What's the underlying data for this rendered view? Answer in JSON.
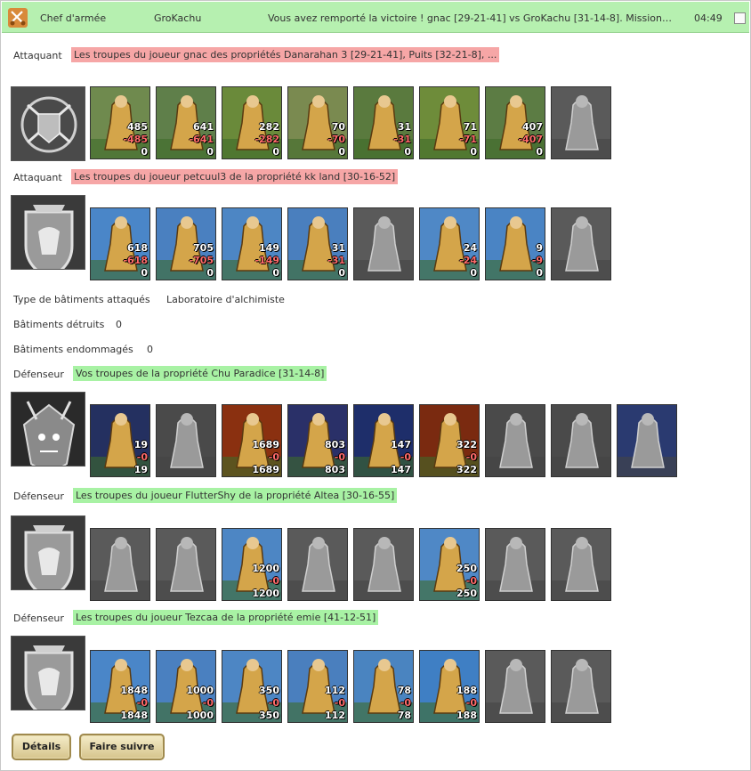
{
  "header": {
    "chef_label": "Chef d'armée",
    "opponent": "GroKachu",
    "message": "Vous avez remporté la victoire ! gnac [29-21-41] vs GroKachu [31-14-8]. Mission…",
    "time": "04:49"
  },
  "battle": {
    "attackers": [
      {
        "label": "Attaquant",
        "troops": "Les troupes du joueur gnac des propriétés Danarahan 3 [29-21-41], Puits [32-21-8], ...",
        "crest_icon": "paladin-crest-icon",
        "units": [
          {
            "icon": "dwarf-unit-icon",
            "count": "485",
            "loss": "-485",
            "remain": "0",
            "color": "#6f8a4e"
          },
          {
            "icon": "swordsman-unit-icon",
            "count": "641",
            "loss": "-641",
            "remain": "0",
            "color": "#5f7f4a"
          },
          {
            "icon": "spearman-unit-icon",
            "count": "282",
            "loss": "-282",
            "remain": "0",
            "color": "#6a8a3a"
          },
          {
            "icon": "griffin-unit-icon",
            "count": "70",
            "loss": "-70",
            "remain": "0",
            "color": "#7a8a50"
          },
          {
            "icon": "archer-unit-icon",
            "count": "31",
            "loss": "-31",
            "remain": "0",
            "color": "#5a7a3e"
          },
          {
            "icon": "elf-mage-unit-icon",
            "count": "71",
            "loss": "-71",
            "remain": "0",
            "color": "#6e8c3a"
          },
          {
            "icon": "monk-unit-icon",
            "count": "407",
            "loss": "-407",
            "remain": "0",
            "color": "#5c7c44"
          },
          {
            "icon": "ogre-unit-icon",
            "count": "",
            "loss": "",
            "remain": "",
            "color": "#5a5a5a"
          }
        ]
      },
      {
        "label": "Attaquant",
        "troops": "Les troupes du joueur petcuul3 de la propriété kk land [30-16-52]",
        "crest_icon": "lion-shield-crest-icon",
        "units": [
          {
            "icon": "dwarf-gold-unit-icon",
            "count": "618",
            "loss": "-618",
            "remain": "0",
            "color": "#4a86c8"
          },
          {
            "icon": "paladin-unit-icon",
            "count": "705",
            "loss": "-705",
            "remain": "0",
            "color": "#4a80c0"
          },
          {
            "icon": "lancer-unit-icon",
            "count": "149",
            "loss": "-149",
            "remain": "0",
            "color": "#4d86c4"
          },
          {
            "icon": "pegasus-unit-icon",
            "count": "31",
            "loss": "-31",
            "remain": "0",
            "color": "#4a7fbe"
          },
          {
            "icon": "crossbow-unit-icon",
            "count": "",
            "loss": "",
            "remain": "",
            "color": "#5a5a5a"
          },
          {
            "icon": "priest-unit-icon",
            "count": "24",
            "loss": "-24",
            "remain": "0",
            "color": "#4f88c6"
          },
          {
            "icon": "guardian-unit-icon",
            "count": "9",
            "loss": "-9",
            "remain": "0",
            "color": "#4a84c4"
          },
          {
            "icon": "ghost-unit-icon",
            "count": "",
            "loss": "",
            "remain": "",
            "color": "#5a5a5a"
          }
        ]
      }
    ],
    "info": {
      "type_label": "Type de bâtiments attaqués",
      "type_value": "Laboratoire d'alchimiste",
      "destroyed_label": "Bâtiments détruits",
      "destroyed_value": "0",
      "damaged_label": "Bâtiments endommagés",
      "damaged_value": "0"
    },
    "defenders": [
      {
        "label": "Défenseur",
        "troops": "Vos troupes de la propriété Chu Paradice [31-14-8]",
        "crest_icon": "demon-crest-icon",
        "units": [
          {
            "icon": "imp-unit-icon",
            "count": "19",
            "loss": "-0",
            "remain": "19",
            "color": "#243060"
          },
          {
            "icon": "skeleton-unit-icon",
            "count": "",
            "loss": "",
            "remain": "",
            "color": "#4a4a4a"
          },
          {
            "icon": "fire-beast-unit-icon",
            "count": "1689",
            "loss": "-0",
            "remain": "1689",
            "color": "#8a3010"
          },
          {
            "icon": "dragon-unit-icon",
            "count": "803",
            "loss": "-0",
            "remain": "803",
            "color": "#2a3068"
          },
          {
            "icon": "fire-elemental-unit-icon",
            "count": "147",
            "loss": "-0",
            "remain": "147",
            "color": "#1e2e6a"
          },
          {
            "icon": "pit-lord-unit-icon",
            "count": "322",
            "loss": "-0",
            "remain": "322",
            "color": "#7a2a10"
          },
          {
            "icon": "warlord-unit-icon",
            "count": "",
            "loss": "",
            "remain": "",
            "color": "#4a4a4a"
          },
          {
            "icon": "wraith-unit-icon",
            "count": "",
            "loss": "",
            "remain": "",
            "color": "#4a4a4a"
          },
          {
            "icon": "war-machine-unit-icon",
            "count": "",
            "loss": "",
            "remain": "",
            "color": "#2a3a70"
          }
        ]
      },
      {
        "label": "Défenseur",
        "troops": "Les troupes du joueur FlutterShy de la propriété Altea [30-16-55]",
        "crest_icon": "lion-shield-crest-icon",
        "units": [
          {
            "icon": "dwarf-gold-unit-icon",
            "count": "",
            "loss": "",
            "remain": "",
            "color": "#5a5a5a"
          },
          {
            "icon": "spearman-unit-icon",
            "count": "",
            "loss": "",
            "remain": "",
            "color": "#5a5a5a"
          },
          {
            "icon": "lancer-unit-icon",
            "count": "1200",
            "loss": "-0",
            "remain": "1200",
            "color": "#4d86c4"
          },
          {
            "icon": "pegasus-unit-icon",
            "count": "",
            "loss": "",
            "remain": "",
            "color": "#5a5a5a"
          },
          {
            "icon": "crossbow-unit-icon",
            "count": "",
            "loss": "",
            "remain": "",
            "color": "#5a5a5a"
          },
          {
            "icon": "priest-unit-icon",
            "count": "250",
            "loss": "-0",
            "remain": "250",
            "color": "#4f88c6"
          },
          {
            "icon": "guardian-unit-icon",
            "count": "",
            "loss": "",
            "remain": "",
            "color": "#5a5a5a"
          },
          {
            "icon": "ghost-unit-icon",
            "count": "",
            "loss": "",
            "remain": "",
            "color": "#5a5a5a"
          }
        ]
      },
      {
        "label": "Défenseur",
        "troops": "Les troupes du joueur Tezcaa de la propriété emie [41-12-51]",
        "crest_icon": "lion-shield-crest-icon",
        "units": [
          {
            "icon": "dwarf-gold-unit-icon",
            "count": "1848",
            "loss": "-0",
            "remain": "1848",
            "color": "#4a86c8"
          },
          {
            "icon": "paladin-unit-icon",
            "count": "1000",
            "loss": "-0",
            "remain": "1000",
            "color": "#4a80c0"
          },
          {
            "icon": "lancer-unit-icon",
            "count": "350",
            "loss": "-0",
            "remain": "350",
            "color": "#4d86c4"
          },
          {
            "icon": "pegasus-unit-icon",
            "count": "112",
            "loss": "-0",
            "remain": "112",
            "color": "#4a7fbe"
          },
          {
            "icon": "archer-unit-icon",
            "count": "78",
            "loss": "-0",
            "remain": "78",
            "color": "#4a84c0"
          },
          {
            "icon": "priest-unit-icon",
            "count": "188",
            "loss": "-0",
            "remain": "188",
            "color": "#3f7fc4"
          },
          {
            "icon": "guardian-unit-icon",
            "count": "",
            "loss": "",
            "remain": "",
            "color": "#5a5a5a"
          },
          {
            "icon": "ghost-unit-icon",
            "count": "",
            "loss": "",
            "remain": "",
            "color": "#5a5a5a"
          }
        ]
      }
    ]
  },
  "buttons": {
    "details": "Détails",
    "forward": "Faire suivre"
  },
  "colors": {
    "header_bg": "#b6f0b0",
    "attacker_tag": "#f6a6a6",
    "defender_tag": "#a8f2a4",
    "loss_text": "#ff6a6a"
  }
}
